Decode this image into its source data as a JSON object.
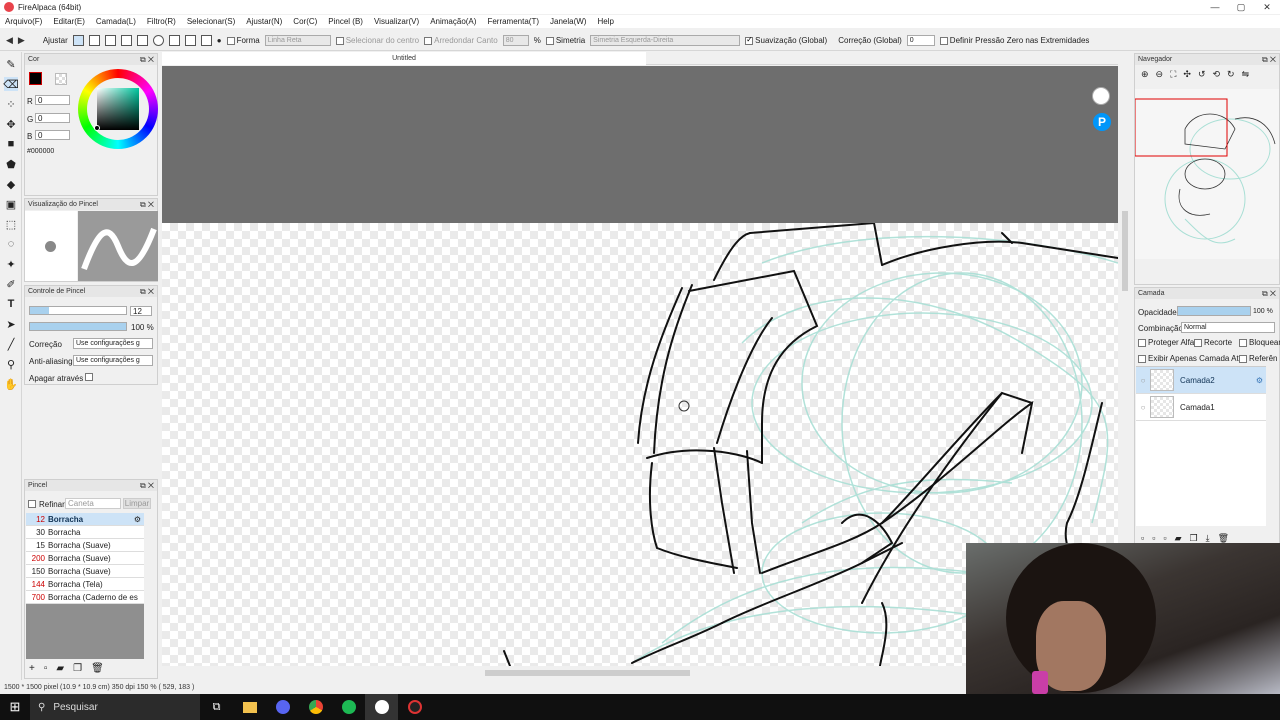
{
  "window": {
    "title": "FireAlpaca (64bit)",
    "controls": [
      "—",
      "▢",
      "✕"
    ]
  },
  "menu": [
    "Arquivo(F)",
    "Editar(E)",
    "Camada(L)",
    "Filtro(R)",
    "Selecionar(S)",
    "Ajustar(N)",
    "Cor(C)",
    "Pincel (B)",
    "Visualizar(V)",
    "Animação(A)",
    "Ferramenta(T)",
    "Janela(W)",
    "Help"
  ],
  "tool_options": {
    "adjust_label": "Ajustar",
    "shape_label": "Forma",
    "shape_value": "Linha Reta",
    "select_center_label": "Selecionar do centro",
    "round_corner_label": "Arredondar Canto",
    "round_corner_value": "80",
    "percent_unit": "%",
    "symmetry_label": "Simetria",
    "symmetry_value": "Simetria Esquerda-Direita",
    "smoothing_label": "Suavização (Global)",
    "correction_label": "Correção (Global)",
    "correction_value": "0",
    "pressure_label": "Definir Pressão Zero nas Extremidades"
  },
  "color_panel": {
    "title": "Cor",
    "r_label": "R",
    "r_value": "0",
    "g_label": "G",
    "g_value": "0",
    "b_label": "B",
    "b_value": "0",
    "hex": "#000000",
    "primary_color": "#000000",
    "secondary_color": "#ffffff"
  },
  "brush_preview_panel": {
    "title": "Visualização do Pincel"
  },
  "brush_control_panel": {
    "title": "Controle de Pincel",
    "size_value": "12",
    "opacity_value": "100 %",
    "correction_label": "Correção",
    "correction_value": "Use configurações g",
    "antialias_label": "Anti-aliasing",
    "antialias_value": "Use configurações g",
    "erase_through_label": "Apagar através"
  },
  "brush_panel": {
    "title": "Pincel",
    "refine_label": "Refinar",
    "pen_label": "Caneta",
    "clear_label": "Limpar",
    "items": [
      {
        "size": "12",
        "name": "Borracha"
      },
      {
        "size": "30",
        "name": "Borracha"
      },
      {
        "size": "15",
        "name": "Borracha (Suave)"
      },
      {
        "size": "200",
        "name": "Borracha (Suave)"
      },
      {
        "size": "150",
        "name": "Borracha (Suave)"
      },
      {
        "size": "144",
        "name": "Borracha (Tela)"
      },
      {
        "size": "700",
        "name": "Borracha (Caderno de es"
      }
    ]
  },
  "canvas": {
    "tab_title": "Untitled"
  },
  "navigator_panel": {
    "title": "Navegador"
  },
  "layer_panel": {
    "title": "Camada",
    "opacity_label": "Opacidade",
    "opacity_value": "100 %",
    "blend_label": "Combinação",
    "blend_value": "Normal",
    "protect_alpha_label": "Proteger Alfa",
    "clipping_label": "Recorte",
    "lock_label": "Bloquear",
    "show_current_only_label": "Exibir Apenas Camada Atu",
    "reference_label": "Referên",
    "layers": [
      {
        "name": "Camada2",
        "selected": true
      },
      {
        "name": "Camada1",
        "selected": false
      }
    ]
  },
  "statusbar": {
    "text": "1500 * 1500 pixel  (10.9 * 10.9 cm)  350 dpi  150 %  ( 529, 183 )"
  },
  "taskbar": {
    "search_placeholder": "Pesquisar"
  },
  "icons": [
    "windows-start-icon",
    "search-icon",
    "task-view-icon",
    "file-explorer-icon",
    "chrome-icon",
    "spotify-icon",
    "firealpaca-icon",
    "recording-icon"
  ]
}
